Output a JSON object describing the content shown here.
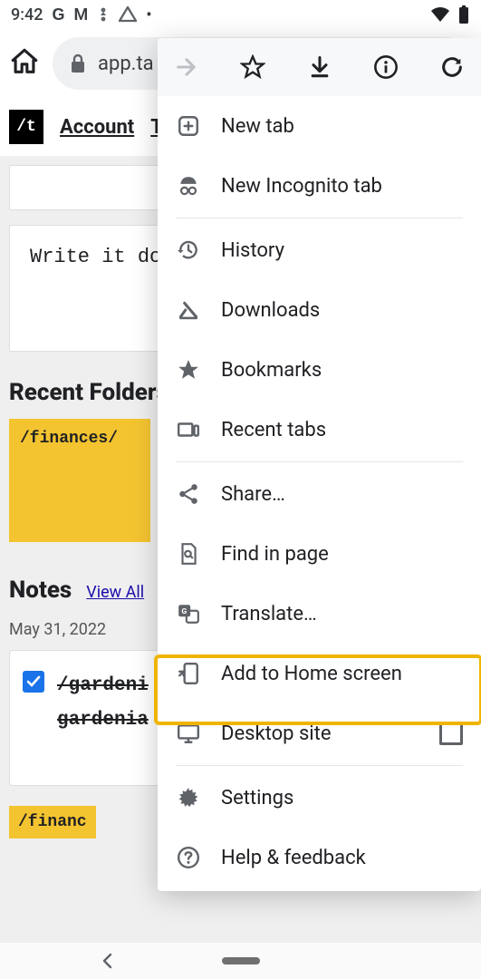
{
  "status": {
    "time": "9:42",
    "g": "G",
    "m": "M"
  },
  "omnibox": {
    "url_visible": "app.ta"
  },
  "app": {
    "logo": "/t",
    "nav_account": "Account",
    "write_prompt": "Write it do",
    "recent_folders_title": "Recent Folders",
    "folder1": "/finances/",
    "notes_title": "Notes",
    "view_all": "View All",
    "date": "May 31, 2022",
    "note_line1": "/gardeni",
    "note_line2": "gardenia",
    "folder2_partial": "/financ"
  },
  "menu": {
    "new_tab": "New tab",
    "incognito": "New Incognito tab",
    "history": "History",
    "downloads": "Downloads",
    "bookmarks": "Bookmarks",
    "recent_tabs": "Recent tabs",
    "share": "Share…",
    "find": "Find in page",
    "translate": "Translate…",
    "add_home": "Add to Home screen",
    "desktop": "Desktop site",
    "settings": "Settings",
    "help": "Help & feedback"
  }
}
